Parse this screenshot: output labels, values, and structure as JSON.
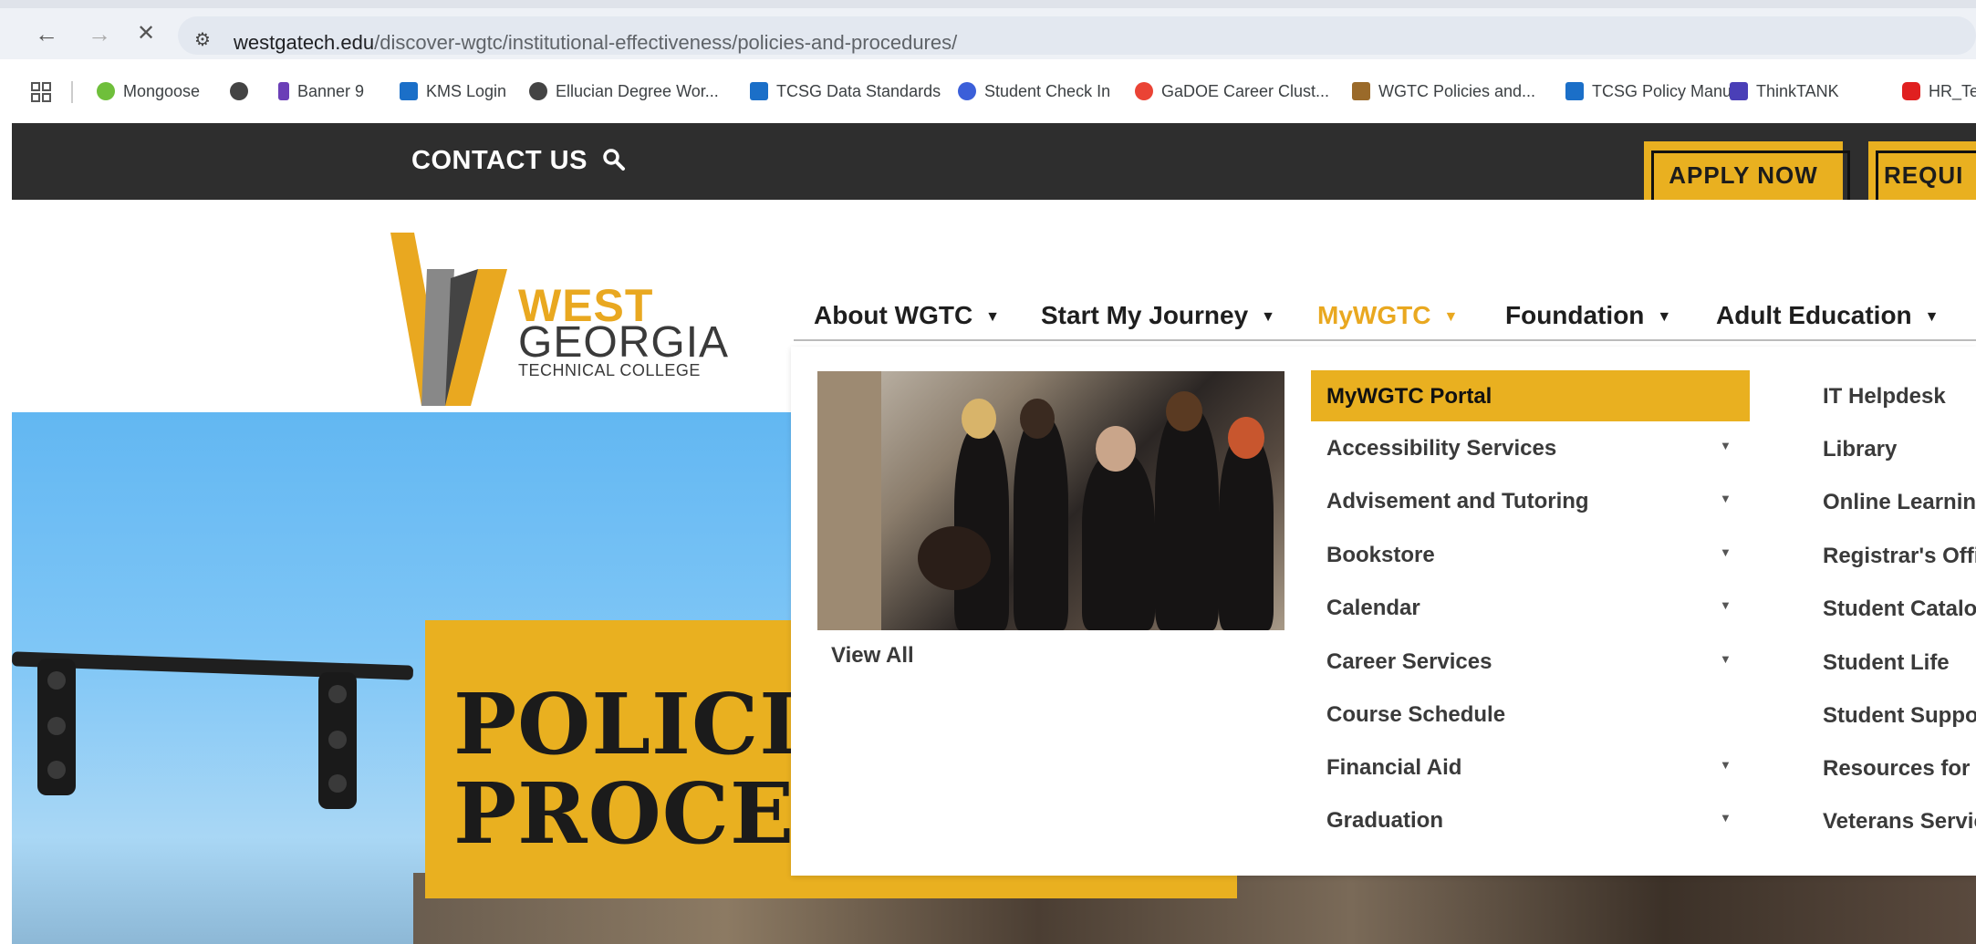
{
  "browser": {
    "back_glyph": "←",
    "forward_glyph": "→",
    "stop_glyph": "✕",
    "tune_glyph": "⚙",
    "url_domain": "westgatech.edu",
    "url_path": "/discover-wgtc/institutional-effectiveness/policies-and-procedures/",
    "bookmarks": [
      {
        "label": "Mongoose",
        "icon": "mongoose-icon",
        "color": "#6fbf3b"
      },
      {
        "label": "",
        "icon": "globe-icon",
        "color": "#444444"
      },
      {
        "label": "Banner 9",
        "icon": "banner-icon",
        "color": "#6b3fb7"
      },
      {
        "label": "KMS Login",
        "icon": "tcsg-icon",
        "color": "#1b6fc8"
      },
      {
        "label": "Ellucian Degree Wor...",
        "icon": "globe-icon",
        "color": "#444444"
      },
      {
        "label": "TCSG Data Standards",
        "icon": "tcsg-icon",
        "color": "#1b6fc8"
      },
      {
        "label": "Student Check In",
        "icon": "check-icon",
        "color": "#3b5fd9"
      },
      {
        "label": "GaDOE Career Clust...",
        "icon": "google-icon",
        "color": "#ea4335"
      },
      {
        "label": "WGTC Policies and...",
        "icon": "wgtc-icon",
        "color": "#9a6a2a"
      },
      {
        "label": "TCSG Policy Manual",
        "icon": "tcsg-icon",
        "color": "#1b6fc8"
      },
      {
        "label": "ThinkTANK",
        "icon": "list-icon",
        "color": "#4a3fb7"
      },
      {
        "label": "HR_Te",
        "icon": "hr-icon",
        "color": "#e02020"
      }
    ]
  },
  "topbar": {
    "contact_label": "CONTACT US",
    "apply_label": "APPLY NOW",
    "request_label": "REQUI"
  },
  "logo": {
    "line1": "WEST",
    "line2": "GEORGIA",
    "line3": "TECHNICAL COLLEGE"
  },
  "nav": {
    "items": [
      {
        "label": "About WGTC",
        "caret": "▼"
      },
      {
        "label": "Start My Journey",
        "caret": "▼"
      },
      {
        "label": "MyWGTC",
        "caret": "▼"
      },
      {
        "label": "Foundation",
        "caret": "▼"
      },
      {
        "label": "Adult Education",
        "caret": "▼"
      }
    ]
  },
  "megamenu": {
    "view_all": "View All",
    "left_items": [
      {
        "label": "MyWGTC Portal",
        "caret": ""
      },
      {
        "label": "Accessibility Services",
        "caret": "▼"
      },
      {
        "label": "Advisement and Tutoring",
        "caret": "▼"
      },
      {
        "label": "Bookstore",
        "caret": "▼"
      },
      {
        "label": "Calendar",
        "caret": "▼"
      },
      {
        "label": "Career Services",
        "caret": "▼"
      },
      {
        "label": "Course Schedule",
        "caret": ""
      },
      {
        "label": "Financial Aid",
        "caret": "▼"
      },
      {
        "label": "Graduation",
        "caret": "▼"
      }
    ],
    "right_items": [
      "IT Helpdesk",
      "Library",
      "Online Learning",
      "Registrar's Offic",
      "Student Catalog",
      "Student Life",
      "Student Suppor",
      "Resources for N",
      "Veterans Servic"
    ]
  },
  "hero": {
    "title_line1": "POLICIE",
    "title_line2": "PROCEI"
  },
  "colors": {
    "accent": "#e9b020",
    "dark_bar": "#2e2e2e"
  }
}
